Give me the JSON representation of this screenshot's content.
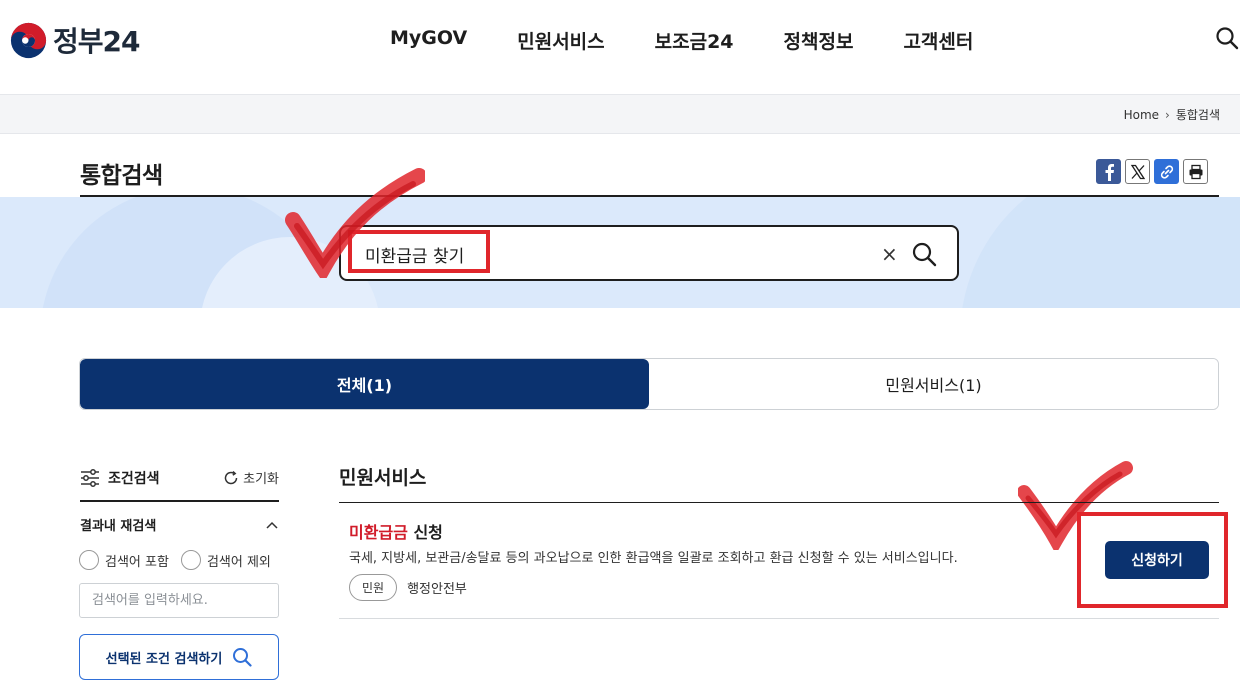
{
  "header": {
    "logo_text": "정부24",
    "nav": [
      "MyGOV",
      "민원서비스",
      "보조금24",
      "정책정보",
      "고객센터"
    ]
  },
  "breadcrumb": {
    "home": "Home",
    "current": "통합검색"
  },
  "page": {
    "title": "통합검색"
  },
  "search": {
    "value": "미환급금 찾기",
    "clear": "×"
  },
  "tabs": [
    {
      "label": "전체(1)",
      "active": true
    },
    {
      "label": "민원서비스(1)",
      "active": false
    }
  ],
  "filter": {
    "title": "조건검색",
    "reset": "초기화",
    "sub_title": "결과내 재검색",
    "include": "검색어 포함",
    "exclude": "검색어 제외",
    "placeholder": "검색어를 입력하세요.",
    "submit": "선택된 조건 검색하기"
  },
  "results": {
    "section": "민원서비스",
    "item": {
      "title_highlight": "미환급금",
      "title_rest": " 신청",
      "desc": "국세, 지방세, 보관금/송달료 등의 과오납으로 인한 환급액을 일괄로 조회하고 환급 신청할 수 있는 서비스입니다.",
      "tag": "민원",
      "agency": "행정안전부",
      "apply": "신청하기"
    }
  },
  "colors": {
    "primary": "#0b326f",
    "highlight": "#d11c2a",
    "annotation": "#e0262b",
    "banner": "#dbe9fb"
  }
}
